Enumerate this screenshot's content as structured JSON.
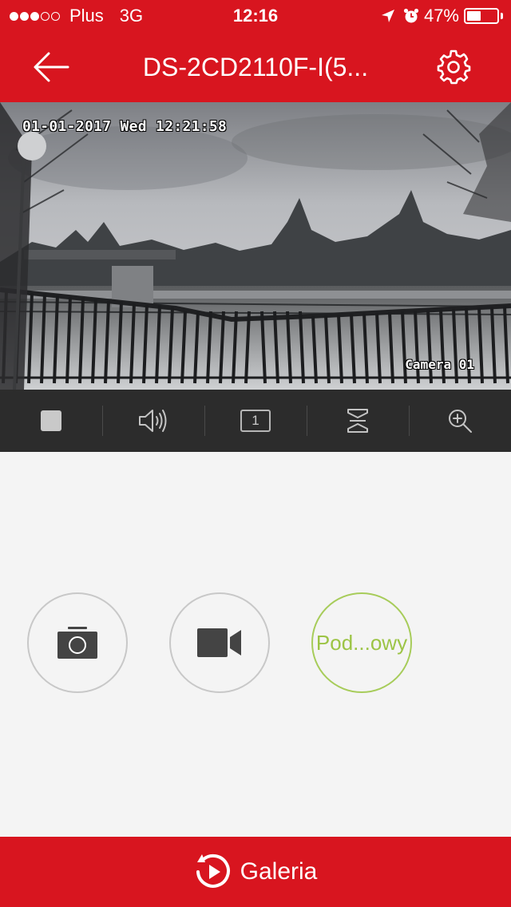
{
  "status_bar": {
    "carrier": "Plus",
    "network": "3G",
    "time": "12:16",
    "battery_percent": "47%",
    "battery_level": 0.47,
    "signal_strength": 3,
    "signal_max": 5
  },
  "nav": {
    "title": "DS-2CD2110F-I(5...",
    "back_icon": "arrow-left-icon",
    "settings_icon": "gear-icon"
  },
  "video": {
    "osd_datetime": "01-01-2017 Wed 12:21:58",
    "osd_camera": "Camera 01"
  },
  "toolbar": {
    "items": [
      {
        "name": "stop-icon"
      },
      {
        "name": "speaker-icon"
      },
      {
        "name": "channel-icon",
        "label": "1"
      },
      {
        "name": "stream-quality-icon"
      },
      {
        "name": "zoom-in-icon"
      }
    ]
  },
  "actions": {
    "preview_label": "Pod...owy",
    "photo_icon": "camera-icon",
    "record_icon": "video-camera-icon"
  },
  "gallery": {
    "label": "Galeria",
    "icon": "playback-icon"
  },
  "colors": {
    "brand_red": "#d8151f",
    "toolbar_dark": "#2c2c2c",
    "preview_green": "#9cc445",
    "background": "#f4f4f4"
  }
}
